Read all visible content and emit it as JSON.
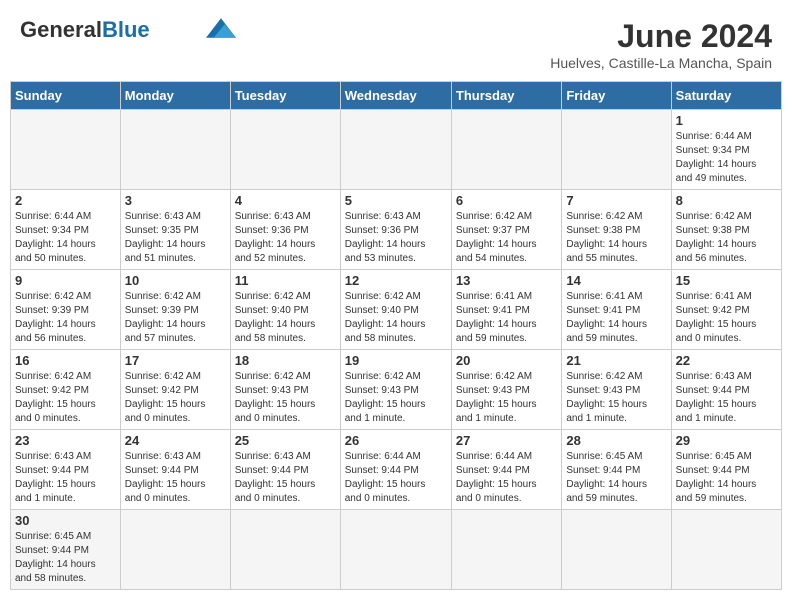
{
  "header": {
    "logo_general": "General",
    "logo_blue": "Blue",
    "month_title": "June 2024",
    "subtitle": "Huelves, Castille-La Mancha, Spain"
  },
  "weekdays": [
    "Sunday",
    "Monday",
    "Tuesday",
    "Wednesday",
    "Thursday",
    "Friday",
    "Saturday"
  ],
  "days": [
    {
      "num": "",
      "info": ""
    },
    {
      "num": "",
      "info": ""
    },
    {
      "num": "",
      "info": ""
    },
    {
      "num": "",
      "info": ""
    },
    {
      "num": "",
      "info": ""
    },
    {
      "num": "",
      "info": ""
    },
    {
      "num": "1",
      "info": "Sunrise: 6:44 AM\nSunset: 9:34 PM\nDaylight: 14 hours\nand 49 minutes."
    },
    {
      "num": "2",
      "info": "Sunrise: 6:44 AM\nSunset: 9:34 PM\nDaylight: 14 hours\nand 50 minutes."
    },
    {
      "num": "3",
      "info": "Sunrise: 6:43 AM\nSunset: 9:35 PM\nDaylight: 14 hours\nand 51 minutes."
    },
    {
      "num": "4",
      "info": "Sunrise: 6:43 AM\nSunset: 9:36 PM\nDaylight: 14 hours\nand 52 minutes."
    },
    {
      "num": "5",
      "info": "Sunrise: 6:43 AM\nSunset: 9:36 PM\nDaylight: 14 hours\nand 53 minutes."
    },
    {
      "num": "6",
      "info": "Sunrise: 6:42 AM\nSunset: 9:37 PM\nDaylight: 14 hours\nand 54 minutes."
    },
    {
      "num": "7",
      "info": "Sunrise: 6:42 AM\nSunset: 9:38 PM\nDaylight: 14 hours\nand 55 minutes."
    },
    {
      "num": "8",
      "info": "Sunrise: 6:42 AM\nSunset: 9:38 PM\nDaylight: 14 hours\nand 56 minutes."
    },
    {
      "num": "9",
      "info": "Sunrise: 6:42 AM\nSunset: 9:39 PM\nDaylight: 14 hours\nand 56 minutes."
    },
    {
      "num": "10",
      "info": "Sunrise: 6:42 AM\nSunset: 9:39 PM\nDaylight: 14 hours\nand 57 minutes."
    },
    {
      "num": "11",
      "info": "Sunrise: 6:42 AM\nSunset: 9:40 PM\nDaylight: 14 hours\nand 58 minutes."
    },
    {
      "num": "12",
      "info": "Sunrise: 6:42 AM\nSunset: 9:40 PM\nDaylight: 14 hours\nand 58 minutes."
    },
    {
      "num": "13",
      "info": "Sunrise: 6:41 AM\nSunset: 9:41 PM\nDaylight: 14 hours\nand 59 minutes."
    },
    {
      "num": "14",
      "info": "Sunrise: 6:41 AM\nSunset: 9:41 PM\nDaylight: 14 hours\nand 59 minutes."
    },
    {
      "num": "15",
      "info": "Sunrise: 6:41 AM\nSunset: 9:42 PM\nDaylight: 15 hours\nand 0 minutes."
    },
    {
      "num": "16",
      "info": "Sunrise: 6:42 AM\nSunset: 9:42 PM\nDaylight: 15 hours\nand 0 minutes."
    },
    {
      "num": "17",
      "info": "Sunrise: 6:42 AM\nSunset: 9:42 PM\nDaylight: 15 hours\nand 0 minutes."
    },
    {
      "num": "18",
      "info": "Sunrise: 6:42 AM\nSunset: 9:43 PM\nDaylight: 15 hours\nand 0 minutes."
    },
    {
      "num": "19",
      "info": "Sunrise: 6:42 AM\nSunset: 9:43 PM\nDaylight: 15 hours\nand 1 minute."
    },
    {
      "num": "20",
      "info": "Sunrise: 6:42 AM\nSunset: 9:43 PM\nDaylight: 15 hours\nand 1 minute."
    },
    {
      "num": "21",
      "info": "Sunrise: 6:42 AM\nSunset: 9:43 PM\nDaylight: 15 hours\nand 1 minute."
    },
    {
      "num": "22",
      "info": "Sunrise: 6:43 AM\nSunset: 9:44 PM\nDaylight: 15 hours\nand 1 minute."
    },
    {
      "num": "23",
      "info": "Sunrise: 6:43 AM\nSunset: 9:44 PM\nDaylight: 15 hours\nand 1 minute."
    },
    {
      "num": "24",
      "info": "Sunrise: 6:43 AM\nSunset: 9:44 PM\nDaylight: 15 hours\nand 0 minutes."
    },
    {
      "num": "25",
      "info": "Sunrise: 6:43 AM\nSunset: 9:44 PM\nDaylight: 15 hours\nand 0 minutes."
    },
    {
      "num": "26",
      "info": "Sunrise: 6:44 AM\nSunset: 9:44 PM\nDaylight: 15 hours\nand 0 minutes."
    },
    {
      "num": "27",
      "info": "Sunrise: 6:44 AM\nSunset: 9:44 PM\nDaylight: 15 hours\nand 0 minutes."
    },
    {
      "num": "28",
      "info": "Sunrise: 6:45 AM\nSunset: 9:44 PM\nDaylight: 14 hours\nand 59 minutes."
    },
    {
      "num": "29",
      "info": "Sunrise: 6:45 AM\nSunset: 9:44 PM\nDaylight: 14 hours\nand 59 minutes."
    },
    {
      "num": "30",
      "info": "Sunrise: 6:45 AM\nSunset: 9:44 PM\nDaylight: 14 hours\nand 58 minutes."
    }
  ]
}
